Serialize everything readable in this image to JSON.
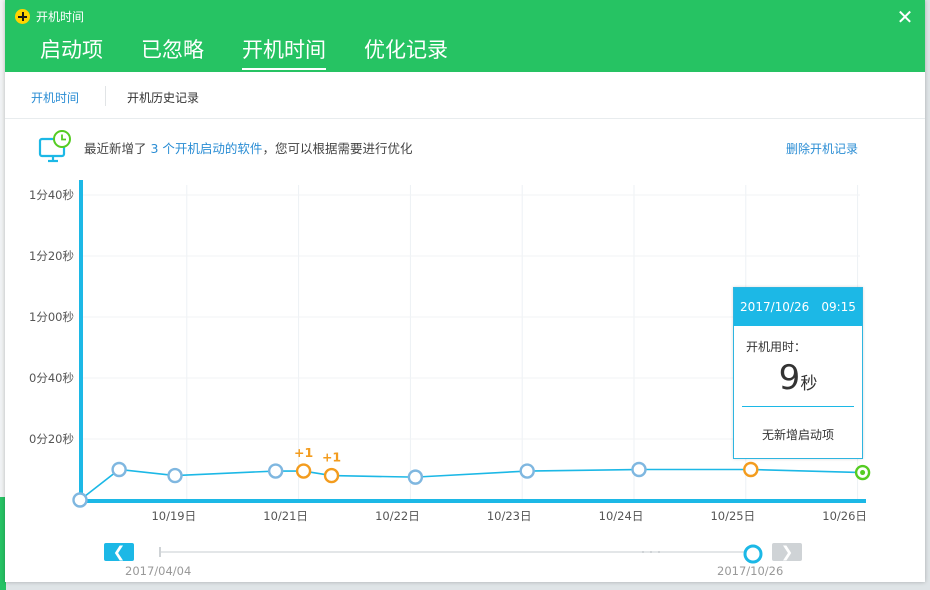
{
  "app_title": "开机时间",
  "close_label": "✕",
  "tabs": [
    {
      "label": "启动项"
    },
    {
      "label": "已忽略"
    },
    {
      "label": "开机时间"
    },
    {
      "label": "优化记录"
    }
  ],
  "subtabs": [
    {
      "label": "开机时间"
    },
    {
      "label": "开机历史记录"
    }
  ],
  "info": {
    "prefix": "最近新增了",
    "highlight": "3 个开机启动的软件",
    "suffix": "，您可以根据需要进行优化"
  },
  "delete_link": "删除开机记录",
  "colors": {
    "header_green": "#26c363",
    "accent_blue": "#1cb8e6",
    "link_blue": "#2a8dd4",
    "point_blue": "#7fb7e0",
    "point_orange": "#f39c1e",
    "point_green": "#55cc22"
  },
  "chart_data": {
    "type": "line",
    "y_ticks": [
      "0分20秒",
      "0分40秒",
      "1分00秒",
      "1分20秒",
      "1分40秒"
    ],
    "y_tick_values": [
      20,
      40,
      60,
      80,
      100
    ],
    "ylim": [
      0,
      105
    ],
    "x_tick_labels": [
      "10/19日",
      "10/21日",
      "10/22日",
      "10/23日",
      "10/24日",
      "10/25日",
      "10/26日"
    ],
    "points": [
      {
        "x": 0,
        "y": 0,
        "kind": "start"
      },
      {
        "x": 0.35,
        "y": 10,
        "kind": "normal"
      },
      {
        "x": 0.85,
        "y": 8,
        "kind": "normal"
      },
      {
        "x": 1.75,
        "y": 9.5,
        "kind": "normal"
      },
      {
        "x": 2.0,
        "y": 9.5,
        "kind": "new",
        "label": "+1"
      },
      {
        "x": 2.25,
        "y": 8,
        "kind": "new",
        "label": "+1"
      },
      {
        "x": 3.0,
        "y": 7.5,
        "kind": "normal"
      },
      {
        "x": 4.0,
        "y": 9.5,
        "kind": "normal"
      },
      {
        "x": 5.0,
        "y": 10,
        "kind": "normal"
      },
      {
        "x": 6.0,
        "y": 10,
        "kind": "new",
        "label": "+1"
      },
      {
        "x": 7.0,
        "y": 9,
        "kind": "current"
      }
    ],
    "x_tick_positions": [
      1,
      2,
      3,
      4,
      5,
      6,
      7
    ]
  },
  "tooltip": {
    "date": "2017/10/26",
    "time": "09:15",
    "label": "开机用时：",
    "value": "9",
    "unit": "秒",
    "note": "无新增启动项"
  },
  "range": {
    "start": "2017/04/04",
    "end": "2017/10/26",
    "prev_label": "❮",
    "next_label": "❯"
  }
}
